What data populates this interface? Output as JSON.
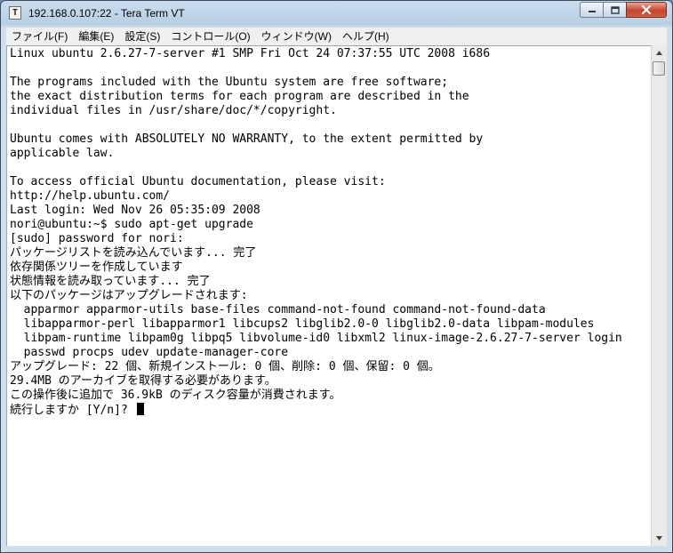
{
  "window": {
    "title": "192.168.0.107:22 - Tera Term VT",
    "icon_glyph": "T"
  },
  "icons": {
    "app": "tera-term-icon",
    "minimize": "minimize-icon",
    "maximize": "maximize-icon",
    "close": "close-icon"
  },
  "colors": {
    "terminal_bg": "#ffffff",
    "terminal_text": "#000000",
    "close_button": "#c4452c"
  },
  "menu": {
    "items": [
      {
        "label": "ファイル(F)"
      },
      {
        "label": "編集(E)"
      },
      {
        "label": "設定(S)"
      },
      {
        "label": "コントロール(O)"
      },
      {
        "label": "ウィンドウ(W)"
      },
      {
        "label": "ヘルプ(H)"
      }
    ]
  },
  "terminal": {
    "lines": [
      "Linux ubuntu 2.6.27-7-server #1 SMP Fri Oct 24 07:37:55 UTC 2008 i686",
      "",
      "The programs included with the Ubuntu system are free software;",
      "the exact distribution terms for each program are described in the",
      "individual files in /usr/share/doc/*/copyright.",
      "",
      "Ubuntu comes with ABSOLUTELY NO WARRANTY, to the extent permitted by",
      "applicable law.",
      "",
      "To access official Ubuntu documentation, please visit:",
      "http://help.ubuntu.com/",
      "Last login: Wed Nov 26 05:35:09 2008",
      "nori@ubuntu:~$ sudo apt-get upgrade",
      "[sudo] password for nori:",
      "パッケージリストを読み込んでいます... 完了",
      "依存関係ツリーを作成しています",
      "状態情報を読み取っています... 完了",
      "以下のパッケージはアップグレードされます:",
      "  apparmor apparmor-utils base-files command-not-found command-not-found-data",
      "  libapparmor-perl libapparmor1 libcups2 libglib2.0-0 libglib2.0-data libpam-modules",
      "  libpam-runtime libpam0g libpq5 libvolume-id0 libxml2 linux-image-2.6.27-7-server login",
      "  passwd procps udev update-manager-core",
      "アップグレード: 22 個、新規インストール: 0 個、削除: 0 個、保留: 0 個。",
      "29.4MB のアーカイブを取得する必要があります。",
      "この操作後に追加で 36.9kB のディスク容量が消費されます。",
      "続行しますか [Y/n]? "
    ]
  }
}
